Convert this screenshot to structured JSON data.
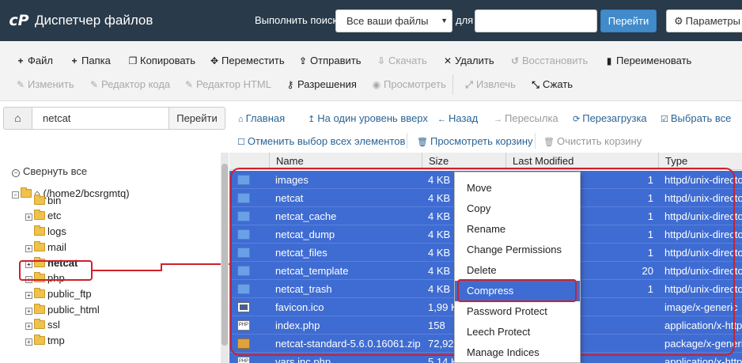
{
  "header": {
    "logo_text": "cP",
    "title": "Диспетчер файлов",
    "search_label": "Выполнить поиск",
    "search_scope": "Все ваши файлы",
    "for_label": "для",
    "search_value": "",
    "go_label": "Перейти",
    "settings_label": "Параметры"
  },
  "toolbar": {
    "row1": [
      {
        "label": "Файл",
        "icon": "plus-icon",
        "glyph": "+",
        "enabled": true
      },
      {
        "label": "Папка",
        "icon": "plus-icon",
        "glyph": "+",
        "enabled": true
      },
      {
        "label": "Копировать",
        "icon": "copy-icon",
        "glyph": "❐",
        "enabled": true
      },
      {
        "label": "Переместить",
        "icon": "move-icon",
        "glyph": "✥",
        "enabled": true
      },
      {
        "label": "Отправить",
        "icon": "upload-icon",
        "glyph": "⇪",
        "enabled": true
      },
      {
        "label": "Скачать",
        "icon": "download-icon",
        "glyph": "⇩",
        "enabled": false
      },
      {
        "label": "Удалить",
        "icon": "close-icon",
        "glyph": "✕",
        "enabled": true
      },
      {
        "label": "Восстановить",
        "icon": "restore-icon",
        "glyph": "↺",
        "enabled": false
      },
      {
        "label": "Переименовать",
        "icon": "file-icon",
        "glyph": "▮",
        "enabled": true
      }
    ],
    "row2": [
      {
        "label": "Изменить",
        "icon": "pencil-icon",
        "glyph": "✎",
        "enabled": false
      },
      {
        "label": "Редактор кода",
        "icon": "edit-icon",
        "glyph": "✎",
        "enabled": false
      },
      {
        "label": "Редактор HTML",
        "icon": "edit-icon",
        "glyph": "✎",
        "enabled": false
      },
      {
        "label": "Разрешения",
        "icon": "key-icon",
        "glyph": "⚷",
        "enabled": true
      },
      {
        "label": "Просмотреть",
        "icon": "eye-icon",
        "glyph": "◉",
        "enabled": false
      },
      {
        "label": "Извлечь",
        "icon": "expand-icon",
        "glyph": "⤢",
        "enabled": false
      },
      {
        "label": "Сжать",
        "icon": "compress-icon",
        "glyph": "⤡",
        "enabled": true
      }
    ]
  },
  "pathbar": {
    "path_value": "netcat",
    "go_label": "Перейти"
  },
  "nav": {
    "row1": [
      {
        "label": "Главная",
        "icon": "home-icon",
        "glyph": "⌂",
        "enabled": true
      },
      {
        "label": "На один уровень вверх",
        "icon": "level-up-icon",
        "glyph": "↥",
        "enabled": true
      },
      {
        "label": "Назад",
        "icon": "arrow-left-icon",
        "glyph": "←",
        "enabled": true
      },
      {
        "label": "Пересылка",
        "icon": "arrow-right-icon",
        "glyph": "→",
        "enabled": false
      },
      {
        "label": "Перезагрузка",
        "icon": "refresh-icon",
        "glyph": "⟳",
        "enabled": true
      },
      {
        "label": "Выбрать все",
        "icon": "check-square-icon",
        "glyph": "☑",
        "enabled": true
      }
    ],
    "row2": [
      {
        "label": "Отменить выбор всех элементов",
        "icon": "square-icon",
        "glyph": "☐",
        "enabled": true
      },
      {
        "label": "Просмотреть корзину",
        "icon": "trash-icon",
        "glyph": "🗑",
        "enabled": true
      },
      {
        "label": "Очистить корзину",
        "icon": "trash-icon",
        "glyph": "🗑",
        "enabled": false
      }
    ]
  },
  "tree": {
    "collapse_label": "Свернуть все",
    "root_label": "(/home2/bcsrgmtq)",
    "children": [
      {
        "label": "bin",
        "toggle": false,
        "bold": false
      },
      {
        "label": "etc",
        "toggle": true,
        "bold": false
      },
      {
        "label": "logs",
        "toggle": false,
        "bold": false
      },
      {
        "label": "mail",
        "toggle": true,
        "bold": false
      },
      {
        "label": "netcat",
        "toggle": true,
        "bold": true
      },
      {
        "label": "php",
        "toggle": true,
        "bold": false
      },
      {
        "label": "public_ftp",
        "toggle": true,
        "bold": false
      },
      {
        "label": "public_html",
        "toggle": true,
        "bold": false
      },
      {
        "label": "ssl",
        "toggle": true,
        "bold": false
      },
      {
        "label": "tmp",
        "toggle": true,
        "bold": false
      }
    ]
  },
  "table": {
    "columns": [
      "Name",
      "Size",
      "Last Modified",
      "Type"
    ],
    "rows": [
      {
        "icon": "folder",
        "name": "images",
        "size": "4 KB",
        "modified": "1",
        "type": "httpd/unix-directory"
      },
      {
        "icon": "folder",
        "name": "netcat",
        "size": "4 KB",
        "modified": "1",
        "type": "httpd/unix-directory"
      },
      {
        "icon": "folder",
        "name": "netcat_cache",
        "size": "4 KB",
        "modified": "1",
        "type": "httpd/unix-directory"
      },
      {
        "icon": "folder",
        "name": "netcat_dump",
        "size": "4 KB",
        "modified": "1",
        "type": "httpd/unix-directory"
      },
      {
        "icon": "folder",
        "name": "netcat_files",
        "size": "4 KB",
        "modified": "1",
        "type": "httpd/unix-directory"
      },
      {
        "icon": "folder",
        "name": "netcat_template",
        "size": "4 KB",
        "modified": "20",
        "type": "httpd/unix-directory"
      },
      {
        "icon": "folder",
        "name": "netcat_trash",
        "size": "4 KB",
        "modified": "1",
        "type": "httpd/unix-directory"
      },
      {
        "icon": "image",
        "name": "favicon.ico",
        "size": "1,99 K",
        "modified": "",
        "type": "image/x-generic"
      },
      {
        "icon": "php",
        "name": "index.php",
        "size": "158",
        "modified": "",
        "type": "application/x-httpd-php"
      },
      {
        "icon": "zip",
        "name": "netcat-standard-5.6.0.16061.zip",
        "size": "72,92",
        "modified": "",
        "type": "package/x-generic"
      },
      {
        "icon": "php",
        "name": "vars.inc.php",
        "size": "5,14 K",
        "modified": "",
        "type": "application/x-httpd-php"
      }
    ]
  },
  "context_menu": {
    "items": [
      {
        "label": "Move",
        "active": false
      },
      {
        "label": "Copy",
        "active": false
      },
      {
        "label": "Rename",
        "active": false
      },
      {
        "label": "Change Permissions",
        "active": false
      },
      {
        "label": "Delete",
        "active": false
      },
      {
        "label": "Compress",
        "active": true
      },
      {
        "label": "Password Protect",
        "active": false
      },
      {
        "label": "Leech Protect",
        "active": false
      },
      {
        "label": "Manage Indices",
        "active": false
      }
    ]
  },
  "colors": {
    "header_bg": "#293a4a",
    "selection": "#3f6cd2",
    "annotation_red": "#d0202a",
    "link": "#2a6496"
  }
}
